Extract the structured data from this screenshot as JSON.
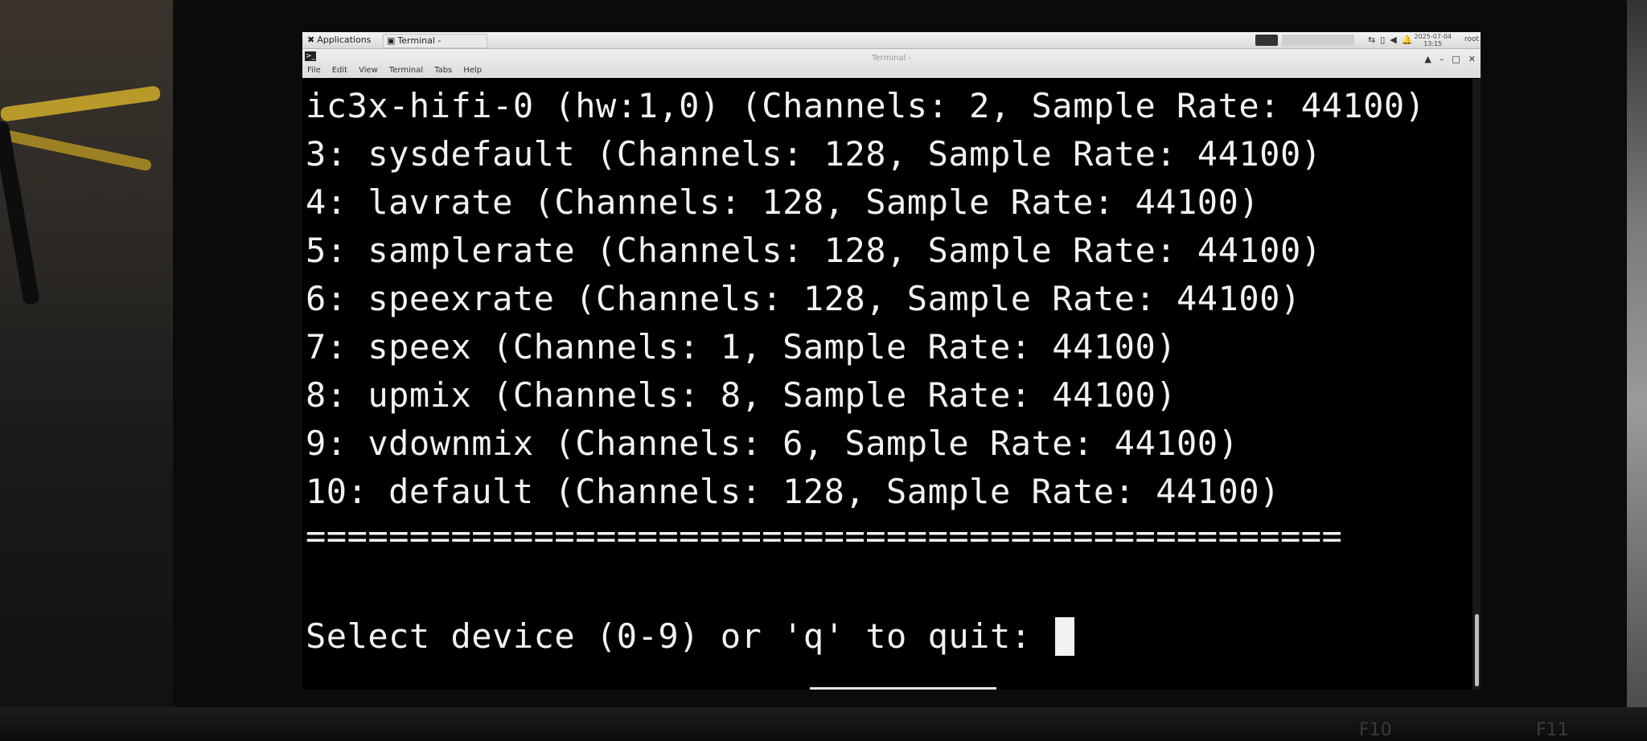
{
  "panel": {
    "applications_label": "Applications",
    "task_label": "Terminal -",
    "clock_date": "2025-07-04",
    "clock_time": "13:15",
    "user": "root"
  },
  "window": {
    "title": "Terminal -",
    "menu": [
      "File",
      "Edit",
      "View",
      "Terminal",
      "Tabs",
      "Help"
    ]
  },
  "terminal": {
    "lines": [
      "ic3x-hifi-0 (hw:1,0) (Channels: 2, Sample Rate: 44100)",
      "3: sysdefault (Channels: 128, Sample Rate: 44100)",
      "4: lavrate (Channels: 128, Sample Rate: 44100)",
      "5: samplerate (Channels: 128, Sample Rate: 44100)",
      "6: speexrate (Channels: 128, Sample Rate: 44100)",
      "7: speex (Channels: 1, Sample Rate: 44100)",
      "8: upmix (Channels: 8, Sample Rate: 44100)",
      "9: vdownmix (Channels: 6, Sample Rate: 44100)",
      "10: default (Channels: 128, Sample Rate: 44100)",
      "=================================================="
    ],
    "prompt": "Select device (0-9) or 'q' to quit: "
  },
  "keyboard": {
    "f10": "F10",
    "f11": "F11"
  }
}
